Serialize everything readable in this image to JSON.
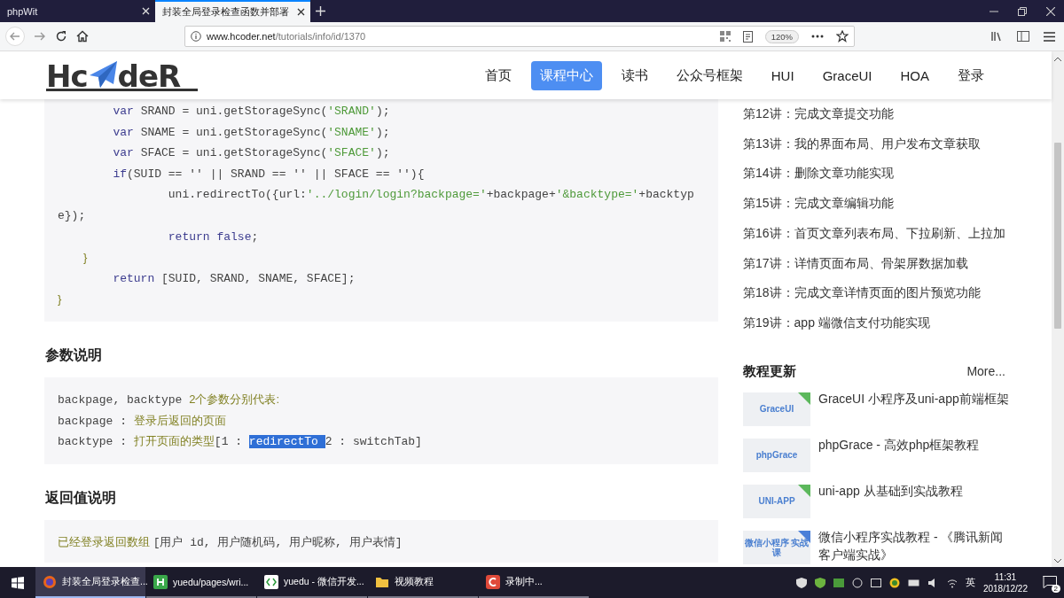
{
  "browser": {
    "tabs": [
      {
        "title": "phpWit",
        "selected": false
      },
      {
        "title": "封装全局登录检查函数并部署",
        "selected": true
      }
    ],
    "url": {
      "host": "www.hcoder.net",
      "path": "/tutorials/info/id/1370"
    },
    "zoom": "120%"
  },
  "site": {
    "logo": {
      "left": "Hc",
      "right": "deR"
    },
    "nav": [
      {
        "label": "首页",
        "selected": false
      },
      {
        "label": "课程中心",
        "selected": true
      },
      {
        "label": "读书",
        "selected": false
      },
      {
        "label": "公众号框架",
        "selected": false
      },
      {
        "label": "HUI",
        "selected": false
      },
      {
        "label": "GraceUI",
        "selected": false
      },
      {
        "label": "HOA",
        "selected": false
      },
      {
        "label": "登录",
        "selected": false
      }
    ]
  },
  "code_block": {
    "lines": [
      [
        {
          "kind": "keyword",
          "text": "        var"
        },
        {
          "kind": "plain",
          "text": " SRAND = uni.getStorageSync("
        },
        {
          "kind": "string",
          "text": "'SRAND'"
        },
        {
          "kind": "plain",
          "text": ");"
        }
      ],
      [
        {
          "kind": "keyword",
          "text": "        var"
        },
        {
          "kind": "plain",
          "text": " SNAME = uni.getStorageSync("
        },
        {
          "kind": "string",
          "text": "'SNAME'"
        },
        {
          "kind": "plain",
          "text": ");"
        }
      ],
      [
        {
          "kind": "keyword",
          "text": "        var"
        },
        {
          "kind": "plain",
          "text": " SFACE = uni.getStorageSync("
        },
        {
          "kind": "string",
          "text": "'SFACE'"
        },
        {
          "kind": "plain",
          "text": ");"
        }
      ],
      [
        {
          "kind": "keyword",
          "text": "        if"
        },
        {
          "kind": "plain",
          "text": "(SUID == '' || SRAND == '' || SFACE == ''){"
        }
      ],
      [
        {
          "kind": "plain",
          "text": "                uni.redirectTo({url:"
        },
        {
          "kind": "string",
          "text": "'../login/login?backpage='"
        },
        {
          "kind": "plain",
          "text": "+backpage+"
        },
        {
          "kind": "string",
          "text": "'&backtype='"
        },
        {
          "kind": "plain",
          "text": "+backtyp"
        }
      ],
      [
        {
          "kind": "plain",
          "text": "e});"
        }
      ],
      [
        {
          "kind": "keyword",
          "text": "                return"
        },
        {
          "kind": "keyword",
          "text": " false"
        },
        {
          "kind": "plain",
          "text": ";"
        }
      ],
      [
        {
          "kind": "note",
          "text": "        }"
        }
      ],
      [
        {
          "kind": "keyword",
          "text": "        return"
        },
        {
          "kind": "plain",
          "text": " [SUID, SRAND, SNAME, SFACE];"
        }
      ],
      [
        {
          "kind": "note",
          "text": "}"
        }
      ]
    ]
  },
  "params": {
    "heading": "参数说明",
    "lines": [
      [
        {
          "kind": "plain",
          "text": "backpage, backtype "
        },
        {
          "kind": "note",
          "text": "2个参数分别代表:"
        }
      ],
      [
        {
          "kind": "plain",
          "text": "backpage : "
        },
        {
          "kind": "note",
          "text": "登录后返回的页面"
        }
      ],
      [
        {
          "kind": "plain",
          "text": "backtype : "
        },
        {
          "kind": "note",
          "text": "打开页面的类型"
        },
        {
          "kind": "plain",
          "text": "[1 : "
        },
        {
          "kind": "selected",
          "text": "redirectTo "
        },
        {
          "kind": "plain",
          "text": "2 : switchTab]"
        }
      ]
    ]
  },
  "returns": {
    "heading": "返回值说明",
    "lines": [
      [
        {
          "kind": "note",
          "text": "已经登录返回数组 "
        },
        {
          "kind": "plain",
          "text": "[用户 id, 用户随机码, 用户昵称, 用户表情]"
        }
      ]
    ]
  },
  "sidebar": {
    "lectures": [
      "第12讲：完成文章提交功能",
      "第13讲：我的界面布局、用户发布文章获取",
      "第14讲：删除文章功能实现",
      "第15讲：完成文章编辑功能",
      "第16讲：首页文章列表布局、下拉刷新、上拉加",
      "第17讲：详情页面布局、骨架屏数据加载",
      "第18讲：完成文章详情页面的图片预览功能",
      "第19讲：app 端微信支付功能实现"
    ],
    "updates": {
      "heading": "教程更新",
      "more": "More...",
      "items": [
        {
          "thumb": "GraceUI",
          "title": "GraceUI 小程序及uni-app前端框架",
          "color": "#5cb85c"
        },
        {
          "thumb": "phpGrace",
          "title": "phpGrace - 高效php框架教程"
        },
        {
          "thumb": "UNI-APP",
          "title": "uni-app 从基础到实战教程",
          "color": "#5cb85c"
        },
        {
          "thumb": "微信小程序 实战课",
          "title": "微信小程序实战教程 - 《腾讯新闻客户端实战》",
          "color": "#4a7fd8"
        }
      ]
    }
  },
  "taskbar": {
    "items": [
      {
        "kind": "browser",
        "label": "封装全局登录检查...",
        "selected": true
      },
      {
        "kind": "editor",
        "label": "yuedu/pages/wri...",
        "selected": false
      },
      {
        "kind": "devtool",
        "label": "yuedu - 微信开发...",
        "selected": false
      },
      {
        "kind": "folder",
        "label": "视频教程",
        "selected": false
      },
      {
        "kind": "recorder",
        "label": "录制中...",
        "selected": false
      }
    ],
    "ime": "英",
    "time": "11:31",
    "date": "2018/12/22",
    "notifications": "2"
  }
}
